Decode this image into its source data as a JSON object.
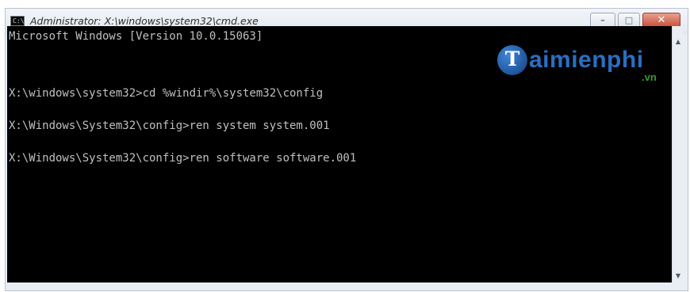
{
  "window": {
    "title": "Administrator: X:\\windows\\system32\\cmd.exe",
    "icon": "cmd-icon",
    "icon_text": "C:\\",
    "controls": {
      "minimize": "–",
      "maximize": "□",
      "close": "✕"
    }
  },
  "console": {
    "lines": [
      "Microsoft Windows [Version 10.0.15063]",
      "",
      "X:\\windows\\system32>cd %windir%\\system32\\config",
      "",
      "X:\\Windows\\System32\\config>ren system system.001",
      "",
      "X:\\Windows\\System32\\config>ren software software.001"
    ]
  },
  "scrollbar": {
    "up": "▲",
    "down": "▼"
  },
  "watermark": {
    "letter": "T",
    "text": "aimienphi",
    "sub": ".vn"
  },
  "colors": {
    "console_bg": "#000000",
    "console_text": "#c0c0c0",
    "watermark_blue": "#2a6fc2",
    "watermark_green": "#3c9a2f",
    "close_red": "#c74b33"
  }
}
